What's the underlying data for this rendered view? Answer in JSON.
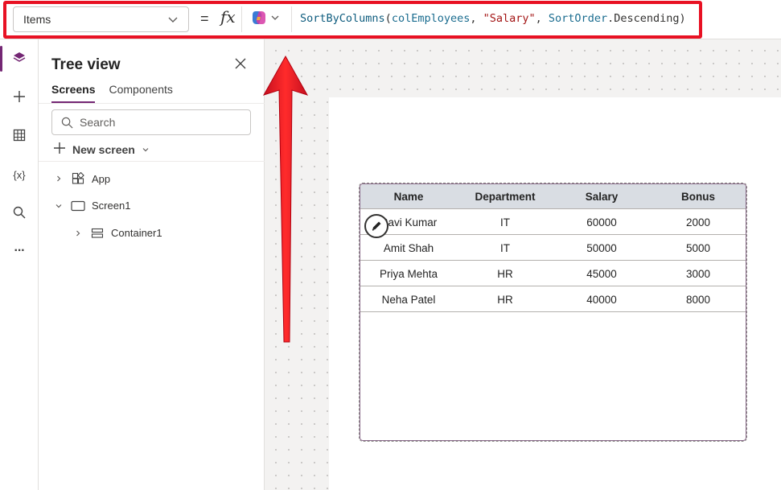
{
  "formula_bar": {
    "property": "Items",
    "equals": "=",
    "fx": "fx",
    "formula": {
      "fn": "SortByColumns",
      "open": "(",
      "arg1": "colEmployees",
      "sep1": ", ",
      "arg2": "\"Salary\"",
      "sep2": ", ",
      "arg3_obj": "SortOrder",
      "arg3_member": ".Descending",
      "close": ")"
    },
    "highlight_color": "#e81123"
  },
  "rail": {
    "icons": [
      "layers-icon",
      "plus-icon",
      "grid-icon",
      "variables-icon",
      "search-icon",
      "more-icon"
    ],
    "variables_glyph": "{x}",
    "more_glyph": "···",
    "active_color": "#742774"
  },
  "tree": {
    "title": "Tree view",
    "tabs": [
      {
        "label": "Screens",
        "active": true
      },
      {
        "label": "Components",
        "active": false
      }
    ],
    "search_placeholder": "Search",
    "new_screen_label": "New screen",
    "nodes": [
      {
        "label": "App",
        "icon": "app-icon"
      },
      {
        "label": "Screen1",
        "icon": "screen-icon"
      },
      {
        "label": "Container1",
        "icon": "container-icon"
      }
    ]
  },
  "table": {
    "headers": [
      "Name",
      "Department",
      "Salary",
      "Bonus"
    ],
    "rows": [
      [
        "Ravi Kumar",
        "IT",
        "60000",
        "2000"
      ],
      [
        "Amit Shah",
        "IT",
        "50000",
        "5000"
      ],
      [
        "Priya Mehta",
        "HR",
        "45000",
        "3000"
      ],
      [
        "Neha Patel",
        "HR",
        "40000",
        "8000"
      ]
    ]
  },
  "annotation": {
    "arrow_color": "#e81123"
  }
}
